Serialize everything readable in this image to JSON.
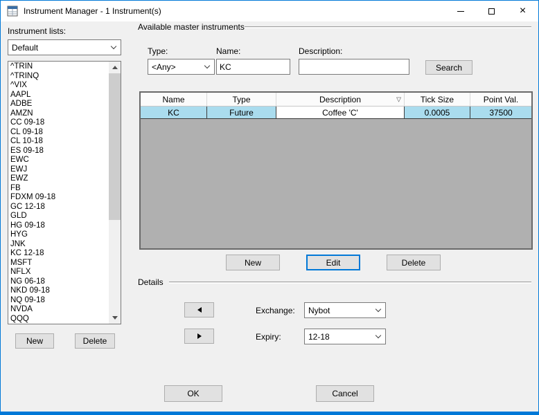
{
  "window": {
    "title": "Instrument Manager - 1 Instrument(s)"
  },
  "left_panel": {
    "label": "Instrument lists:",
    "selected_list": "Default",
    "symbols": [
      "^TRIN",
      "^TRINQ",
      "^VIX",
      "AAPL",
      "ADBE",
      "AMZN",
      "CC 09-18",
      "CL 09-18",
      "CL 10-18",
      "ES 09-18",
      "EWC",
      "EWJ",
      "EWZ",
      "FB",
      "FDXM 09-18",
      "GC 12-18",
      "GLD",
      "HG 09-18",
      "HYG",
      "JNK",
      "KC 12-18",
      "MSFT",
      "NFLX",
      "NG 06-18",
      "NKD 09-18",
      "NQ 09-18",
      "NVDA",
      "QQQ"
    ],
    "new_button": "New",
    "delete_button": "Delete"
  },
  "master_panel": {
    "group_label": "Available master instruments",
    "type_label": "Type:",
    "type_value": "<Any>",
    "name_label": "Name:",
    "name_value": "KC",
    "description_label": "Description:",
    "description_value": "",
    "search_button": "Search",
    "table": {
      "columns": [
        "Name",
        "Type",
        "Description",
        "Tick Size",
        "Point Val."
      ],
      "rows": [
        [
          "KC",
          "Future",
          "Coffee 'C'",
          "0.0005",
          "37500"
        ]
      ]
    },
    "new_button": "New",
    "edit_button": "Edit",
    "delete_button": "Delete"
  },
  "details_panel": {
    "group_label": "Details",
    "exchange_label": "Exchange:",
    "exchange_value": "Nybot",
    "expiry_label": "Expiry:",
    "expiry_value": "12-18"
  },
  "footer": {
    "ok_button": "OK",
    "cancel_button": "Cancel"
  },
  "icons": {
    "close": "×",
    "sort_desc": "▽"
  },
  "colors": {
    "accent": "#0078d7",
    "selection": "#aadcee",
    "table_body": "#b0b0b0",
    "dialog_bg": "#f0f0f0"
  }
}
